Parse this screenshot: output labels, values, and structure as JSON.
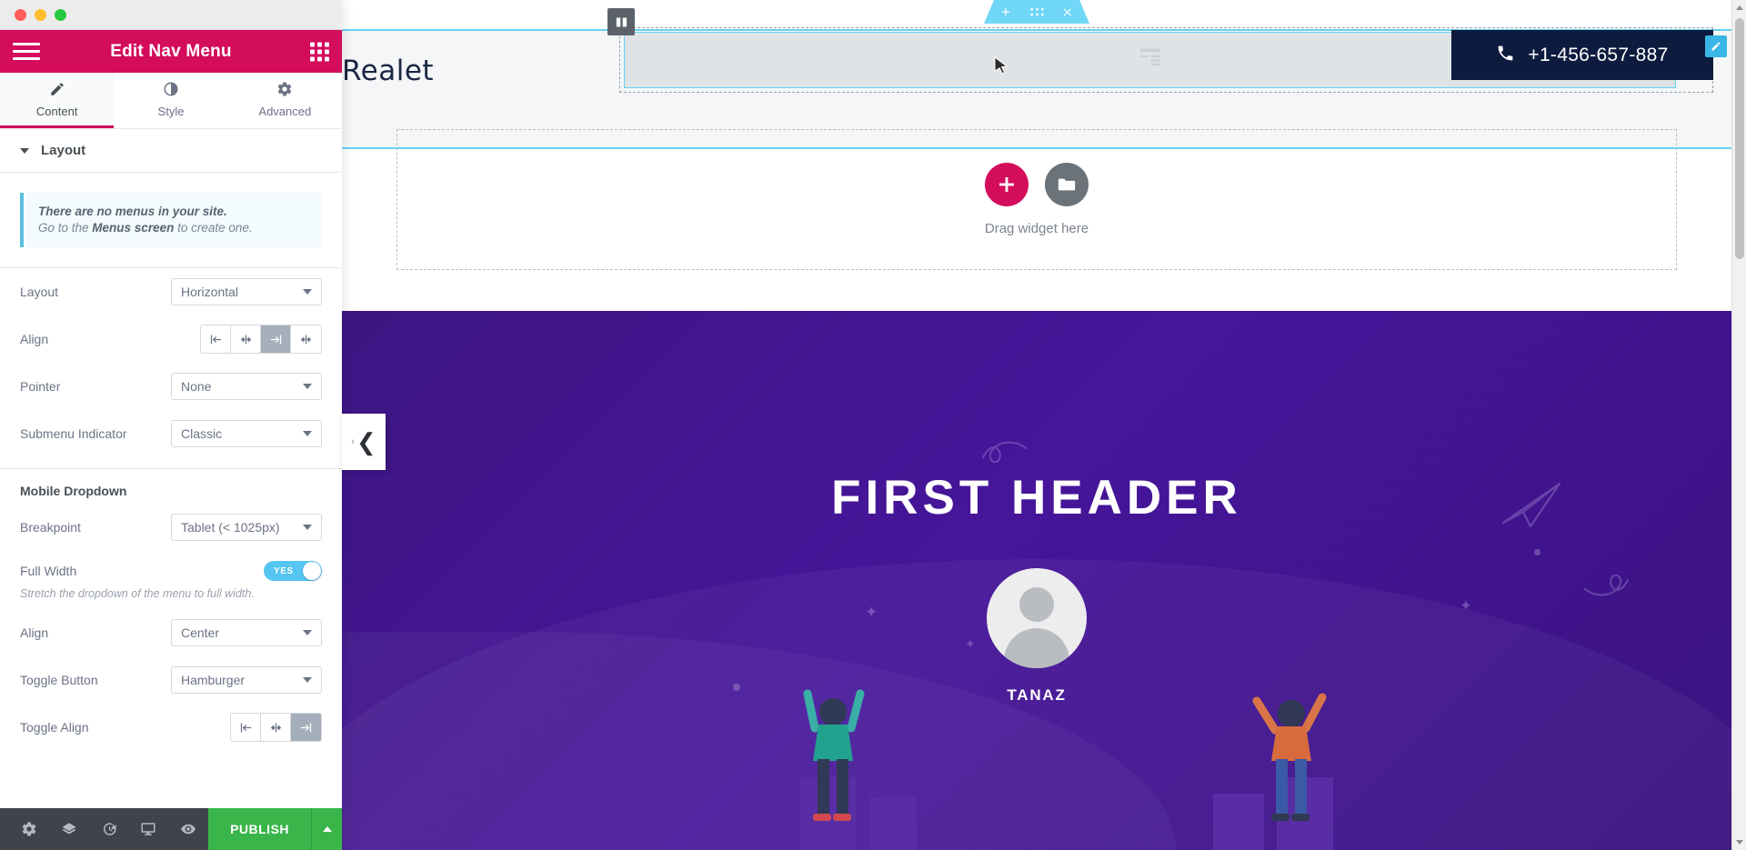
{
  "window": {
    "traffic_lights": [
      "close",
      "minimize",
      "maximize"
    ]
  },
  "panel": {
    "title": "Edit Nav Menu",
    "menu_icon": "hamburger-icon",
    "widgets_icon": "grid-apps-icon",
    "tabs": [
      {
        "label": "Content",
        "icon": "pencil-icon",
        "active": true
      },
      {
        "label": "Style",
        "icon": "contrast-circle-icon",
        "active": false
      },
      {
        "label": "Advanced",
        "icon": "gear-icon",
        "active": false
      }
    ],
    "section": {
      "title": "Layout",
      "expanded": true
    },
    "notice": {
      "line1": "There are no menus in your site.",
      "line2_prefix": "Go to the ",
      "line2_strong": "Menus screen",
      "line2_suffix": " to create one."
    },
    "controls": [
      {
        "label": "Layout",
        "type": "select",
        "value": "Horizontal"
      },
      {
        "label": "Align",
        "type": "buttongroup",
        "options": [
          "align-left",
          "align-center",
          "align-right",
          "align-justify"
        ],
        "selected_index": 2
      },
      {
        "label": "Pointer",
        "type": "select",
        "value": "None"
      },
      {
        "label": "Submenu Indicator",
        "type": "select",
        "value": "Classic"
      }
    ],
    "mobile_dropdown": {
      "heading": "Mobile Dropdown",
      "breakpoint": {
        "label": "Breakpoint",
        "value": "Tablet (< 1025px)"
      },
      "full_width": {
        "label": "Full Width",
        "toggle_text": "YES",
        "enabled": true,
        "hint": "Stretch the dropdown of the menu to full width."
      },
      "align": {
        "label": "Align",
        "value": "Center"
      },
      "toggle_button": {
        "label": "Toggle Button",
        "value": "Hamburger"
      },
      "toggle_align": {
        "label": "Toggle Align",
        "options": [
          "align-left",
          "align-center",
          "align-right"
        ],
        "selected_index": 2
      }
    },
    "footer": {
      "icons": [
        "gear-icon",
        "layers-icon",
        "history-icon",
        "responsive-monitor-icon",
        "eye-preview-icon"
      ],
      "publish_label": "PUBLISH",
      "publish_color": "#39b54a",
      "dropdown_icon": "chevron-up-icon"
    }
  },
  "canvas": {
    "section_toolbar": {
      "add_icon": "plus-icon",
      "drag_icon": "dots-grid-icon",
      "close_icon": "close-x-icon"
    },
    "column_handle_icon": "columns-icon",
    "edit_pencil_icon": "pencil-edit-icon",
    "placeholder_widget_icon": "nav-menu-widget-icon",
    "logo_text": "Realet",
    "phone": {
      "icon": "phone-icon",
      "number": "+1-456-657-887",
      "background": "#0d1b3e"
    },
    "dropzone": {
      "add_widget_icon": "plus-icon",
      "add_template_icon": "folder-icon",
      "label": "Drag widget here"
    },
    "hero": {
      "title": "FIRST HEADER",
      "avatar_icon": "user-avatar-icon",
      "name": "TANAZ",
      "background_color": "#46159a"
    },
    "collapse_panel": {
      "small_chevron": "‹",
      "large_chevron": "❮"
    }
  },
  "scrollbar": {
    "up_icon": "scroll-up-arrow",
    "down_icon": "scroll-down-arrow"
  }
}
